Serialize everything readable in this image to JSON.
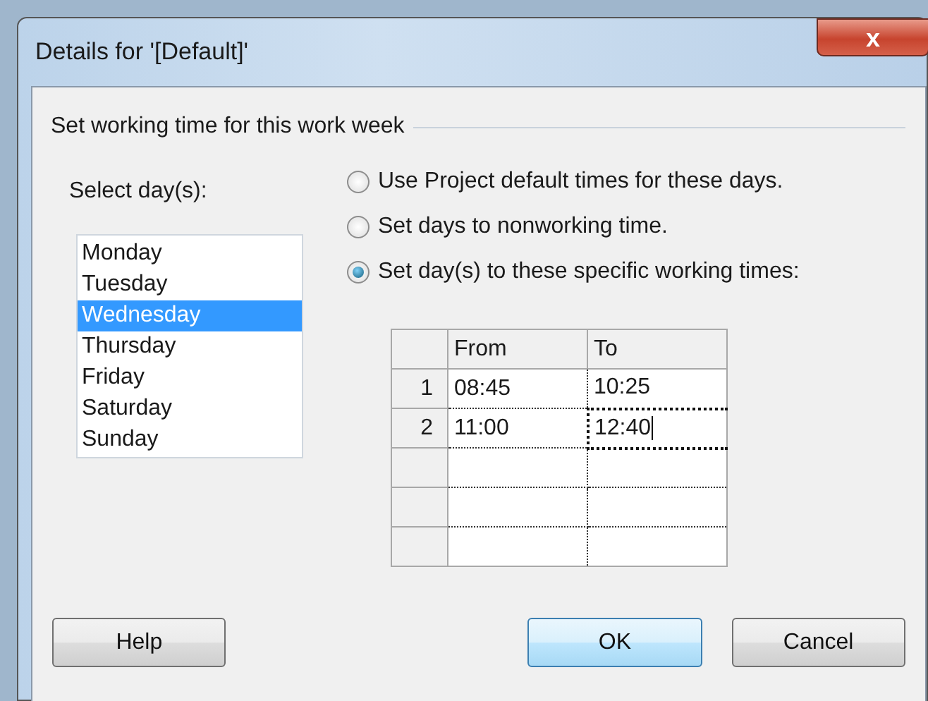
{
  "window": {
    "title": "Details for '[Default]'",
    "close": "x"
  },
  "group_title": "Set working time for this work week",
  "days_label": "Select day(s):",
  "days": [
    {
      "label": "Monday",
      "selected": false
    },
    {
      "label": "Tuesday",
      "selected": false
    },
    {
      "label": "Wednesday",
      "selected": true
    },
    {
      "label": "Thursday",
      "selected": false
    },
    {
      "label": "Friday",
      "selected": false
    },
    {
      "label": "Saturday",
      "selected": false
    },
    {
      "label": "Sunday",
      "selected": false
    }
  ],
  "options": [
    {
      "label": "Use Project default times for these days.",
      "selected": false
    },
    {
      "label": "Set days to nonworking time.",
      "selected": false
    },
    {
      "label": "Set day(s) to these specific working times:",
      "selected": true
    }
  ],
  "table": {
    "columns": [
      "From",
      "To"
    ],
    "rows": [
      {
        "number": "1",
        "from": "08:45",
        "to": "10:25",
        "editing": false
      },
      {
        "number": "2",
        "from": "11:00",
        "to": "12:40",
        "editing": true
      }
    ]
  },
  "buttons": [
    {
      "label": "Help",
      "default": false
    },
    {
      "label": "OK",
      "default": true
    },
    {
      "label": "Cancel",
      "default": false
    }
  ]
}
